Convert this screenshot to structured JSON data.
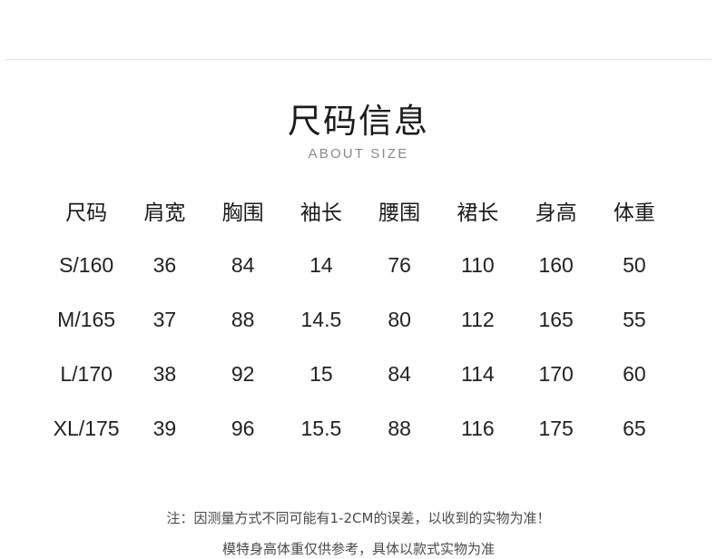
{
  "title": "尺码信息",
  "subtitle": "ABOUT SIZE",
  "table": {
    "headers": [
      "尺码",
      "肩宽",
      "胸围",
      "袖长",
      "腰围",
      "裙长",
      "身高",
      "体重"
    ],
    "rows": [
      [
        "S/160",
        "36",
        "84",
        "14",
        "76",
        "110",
        "160",
        "50"
      ],
      [
        "M/165",
        "37",
        "88",
        "14.5",
        "80",
        "112",
        "165",
        "55"
      ],
      [
        "L/170",
        "38",
        "92",
        "15",
        "84",
        "114",
        "170",
        "60"
      ],
      [
        "XL/175",
        "39",
        "96",
        "15.5",
        "88",
        "116",
        "175",
        "65"
      ]
    ]
  },
  "notes": [
    "注：因测量方式不同可能有1-2CM的误差，以收到的实物为准！",
    "模特身高体重仅供参考，具体以款式实物为准"
  ]
}
